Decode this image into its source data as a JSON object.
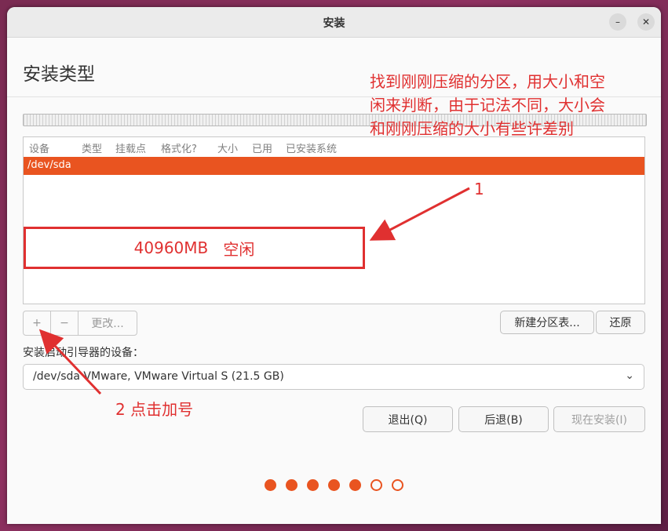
{
  "window": {
    "title": "安装"
  },
  "page": {
    "heading": "安装类型"
  },
  "table": {
    "columns": [
      "设备",
      "类型",
      "挂载点",
      "格式化?",
      "大小",
      "已用",
      "已安装系统"
    ],
    "selected_row": "/dev/sda",
    "free_space": {
      "size": "40960MB",
      "label": "空闲"
    }
  },
  "toolbar": {
    "add": "+",
    "remove": "−",
    "change": "更改..."
  },
  "buttons": {
    "new_partition_table": "新建分区表...",
    "revert": "还原",
    "quit": "退出(Q)",
    "back": "后退(B)",
    "install_now": "现在安装(I)"
  },
  "boot_loader": {
    "label": "安装启动引导器的设备：",
    "selected": "/dev/sda VMware, VMware Virtual S (21.5 GB)"
  },
  "progress": {
    "total_steps": 7,
    "completed_steps": 5
  },
  "annotations": {
    "note_lines": [
      "找到刚刚压缩的分区，用大小和空",
      "闲来判断，由于记法不同，大小会",
      "和刚刚压缩的大小有些许差别"
    ],
    "marker_1": "1",
    "marker_2": "2 点击加号"
  },
  "colors": {
    "accent": "#e95420",
    "annotation": "#e03030"
  }
}
